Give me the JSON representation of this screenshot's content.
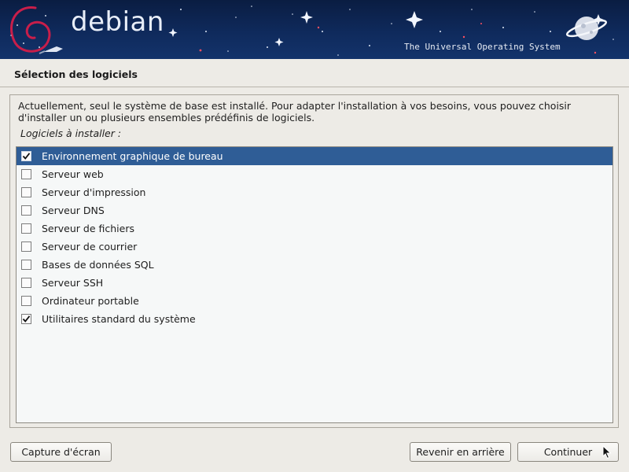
{
  "banner": {
    "logo_text": "debian",
    "tagline": "The Universal Operating System",
    "icons": [
      "debian-swirl-icon",
      "rocket-icon",
      "planet-icon"
    ]
  },
  "step": {
    "title": "Sélection des logiciels"
  },
  "content": {
    "description_line1": "Actuellement, seul le système de base est installé. Pour adapter l'installation à vos besoins, vous pouvez choisir",
    "description_line2": "d'installer un ou plusieurs ensembles prédéfinis de logiciels.",
    "list_label": "Logiciels à installer :",
    "items": [
      {
        "label": "Environnement graphique de bureau",
        "checked": true,
        "selected": true
      },
      {
        "label": "Serveur web",
        "checked": false,
        "selected": false
      },
      {
        "label": "Serveur d'impression",
        "checked": false,
        "selected": false
      },
      {
        "label": "Serveur DNS",
        "checked": false,
        "selected": false
      },
      {
        "label": "Serveur de fichiers",
        "checked": false,
        "selected": false
      },
      {
        "label": "Serveur de courrier",
        "checked": false,
        "selected": false
      },
      {
        "label": "Bases de données SQL",
        "checked": false,
        "selected": false
      },
      {
        "label": "Serveur SSH",
        "checked": false,
        "selected": false
      },
      {
        "label": "Ordinateur portable",
        "checked": false,
        "selected": false
      },
      {
        "label": "Utilitaires standard du système",
        "checked": true,
        "selected": false
      }
    ]
  },
  "buttons": {
    "screenshot": "Capture d'écran",
    "back": "Revenir en arrière",
    "continue": "Continuer"
  },
  "colors": {
    "banner": "#0f2a5c",
    "selection": "#2f5d96",
    "background": "#edebe6",
    "list_background": "#f6f8f8"
  }
}
